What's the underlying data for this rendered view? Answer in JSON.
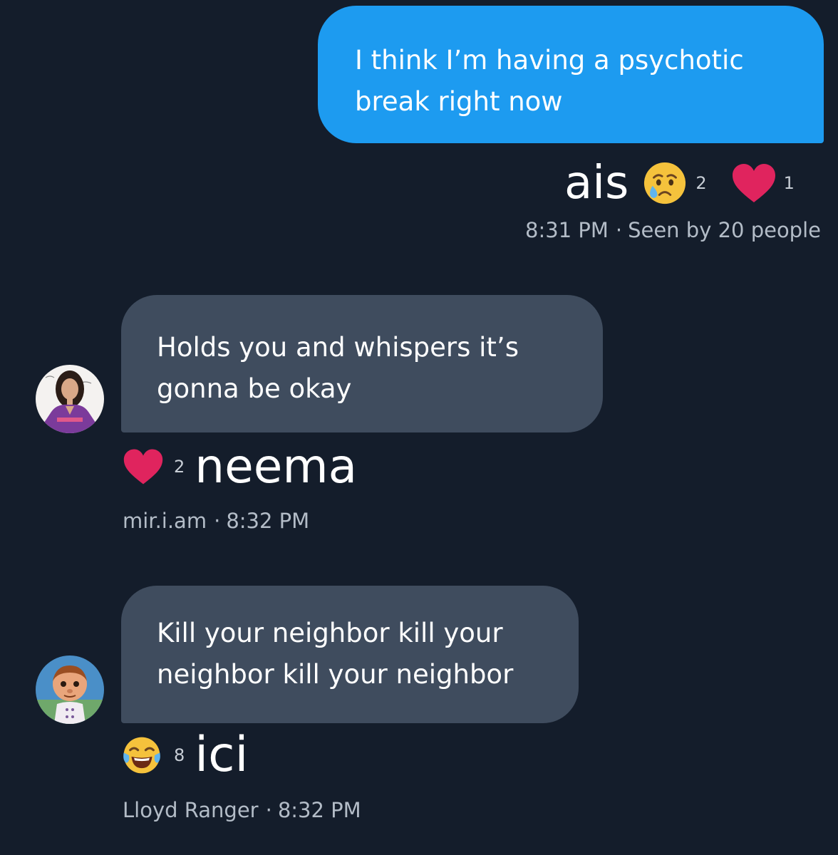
{
  "colors": {
    "background": "#141d2b",
    "sent_bubble": "#1d9bf0",
    "received_bubble": "#3f4c5e",
    "heart": "#e0245e",
    "meta_text": "#b3bcc7"
  },
  "messages": [
    {
      "direction": "sent",
      "lines": [
        "I think I’m having a psychotic",
        "break right now"
      ],
      "caption": "ais",
      "reactions": [
        {
          "icon": "crying-face-icon",
          "count": "2"
        },
        {
          "icon": "heart-icon",
          "count": "1"
        }
      ],
      "time": "8:31 PM",
      "status": "Seen by 20 people"
    },
    {
      "direction": "received",
      "avatar": "avatar-woman-purple-dress",
      "lines": [
        "Holds you and whispers it’s",
        "gonna be okay"
      ],
      "reactions": [
        {
          "icon": "heart-icon",
          "count": "2"
        }
      ],
      "caption": "neema",
      "sender": "mir.i.am",
      "time": "8:32 PM"
    },
    {
      "direction": "received",
      "avatar": "avatar-cartoon-puppet",
      "lines": [
        "Kill your neighbor kill your",
        "neighbor kill your neighbor"
      ],
      "reactions": [
        {
          "icon": "tears-of-joy-icon",
          "count": "8"
        }
      ],
      "caption": "ici",
      "sender": "Lloyd Ranger",
      "time": "8:32 PM"
    }
  ],
  "separator": "·"
}
